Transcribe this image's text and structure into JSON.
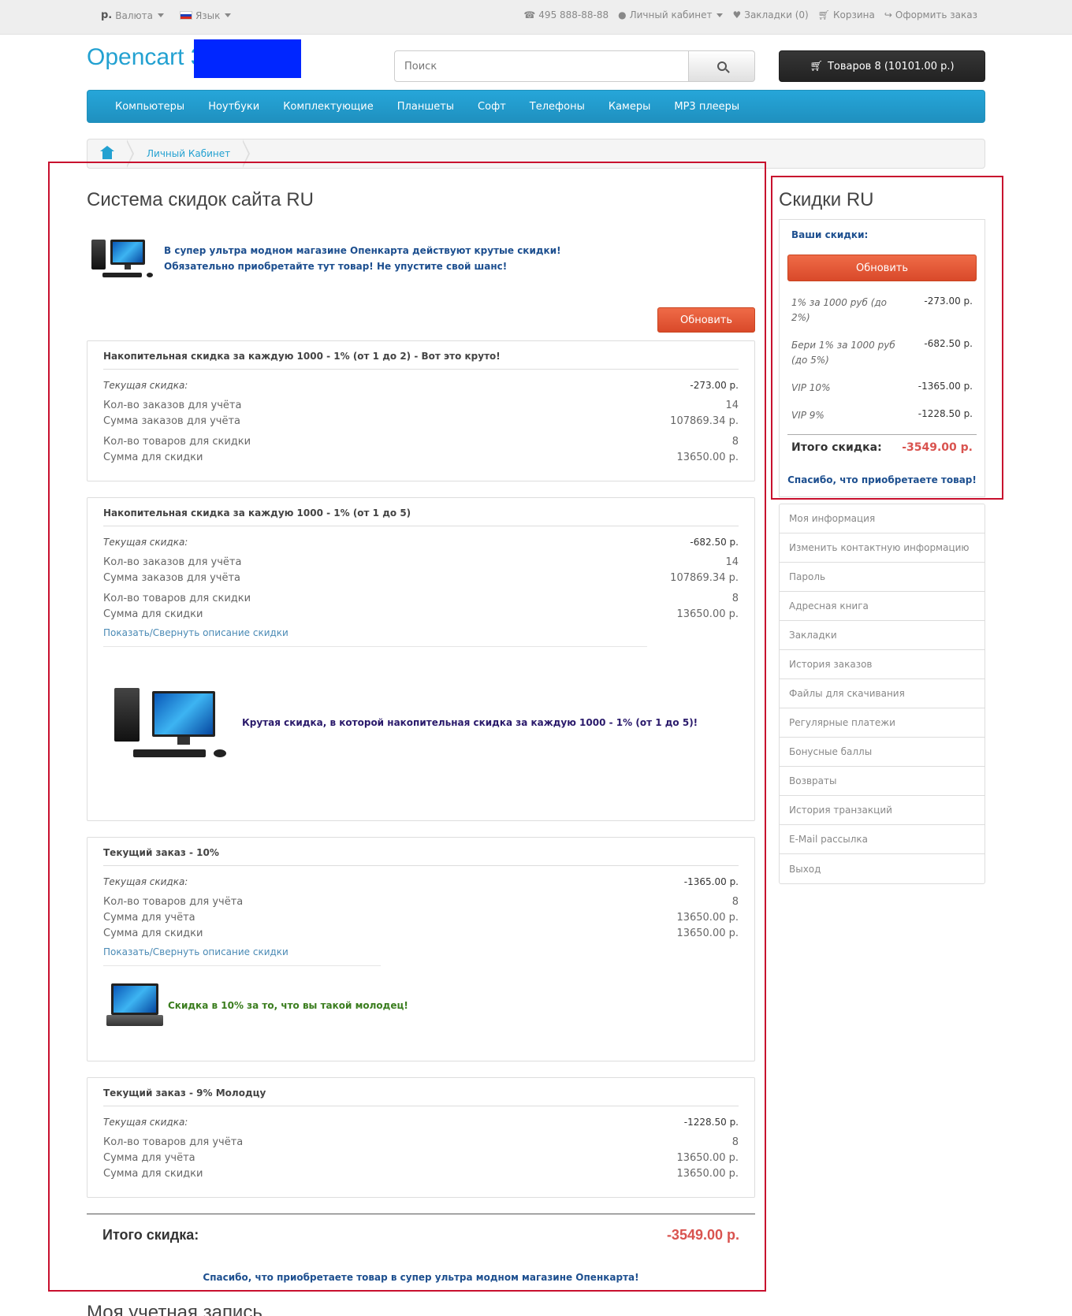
{
  "topbar": {
    "currency_symbol": "р.",
    "currency_label": "Валюта",
    "language_label": "Язык",
    "phone": "495 888-88-88",
    "account": "Личный кабинет",
    "wishlist": "Закладки (0)",
    "cart": "Корзина",
    "checkout": "Оформить заказ"
  },
  "header": {
    "logo": "Opencart 3",
    "search_placeholder": "Поиск",
    "cart_button": "Товаров 8 (10101.00 р.)"
  },
  "menu": [
    "Компьютеры",
    "Ноутбуки",
    "Комплектующие",
    "Планшеты",
    "Софт",
    "Телефоны",
    "Камеры",
    "MP3 плееры"
  ],
  "breadcrumb": {
    "link": "Личный Кабинет"
  },
  "main": {
    "title": "Система скидок сайта RU",
    "intro_line1": "В супер ультра модном магазине Опенкарта действуют крутые скидки!",
    "intro_line2": "Обязательно приобретайте тут товар! Не упустите свой шанс!",
    "refresh_button": "Обновить",
    "current_label": "Текущая скидка:",
    "toggle_label": "Показать/Свернуть описание скидки",
    "panels": [
      {
        "title": "Накопительная скидка за каждую 1000 - 1% (от 1 до 2) - Вот это круто!",
        "current": "-273.00 р.",
        "rows": [
          {
            "label": "Кол-во заказов для учёта",
            "value": "14"
          },
          {
            "label": "Сумма заказов для учёта",
            "value": "107869.34 р."
          },
          {
            "label": "Кол-во товаров для скидки",
            "value": "8"
          },
          {
            "label": "Сумма для скидки",
            "value": "13650.00 р."
          }
        ]
      },
      {
        "title": "Накопительная скидка за каждую 1000 - 1% (от 1 до 5)",
        "current": "-682.50 р.",
        "rows": [
          {
            "label": "Кол-во заказов для учёта",
            "value": "14"
          },
          {
            "label": "Сумма заказов для учёта",
            "value": "107869.34 р."
          },
          {
            "label": "Кол-во товаров для скидки",
            "value": "8"
          },
          {
            "label": "Сумма для скидки",
            "value": "13650.00 р."
          }
        ],
        "description": "Крутая скидка, в которой накопительная скидка за каждую 1000 - 1% (от 1 до 5)!"
      },
      {
        "title": "Текущий заказ - 10%",
        "current": "-1365.00 р.",
        "rows": [
          {
            "label": "Кол-во товаров для учёта",
            "value": "8"
          },
          {
            "label": "Сумма для учёта",
            "value": "13650.00 р."
          },
          {
            "label": "Сумма для скидки",
            "value": "13650.00 р."
          }
        ],
        "description": "Скидка в 10% за то, что вы такой молодец!"
      },
      {
        "title": "Текущий заказ - 9% Молодцу",
        "current": "-1228.50 р.",
        "rows": [
          {
            "label": "Кол-во товаров для учёта",
            "value": "8"
          },
          {
            "label": "Сумма для учёта",
            "value": "13650.00 р."
          },
          {
            "label": "Сумма для скидки",
            "value": "13650.00 р."
          }
        ]
      }
    ],
    "total_label": "Итого скидка:",
    "total_value": "-3549.00 р.",
    "thanks": "Спасибо, что приобретаете товар в супер ультра модном магазине Опенкарта!",
    "next_heading": "Моя учетная запись"
  },
  "sidebar": {
    "title": "Скидки RU",
    "subtitle": "Ваши скидки:",
    "refresh_button": "Обновить",
    "discounts": [
      {
        "name": "1% за 1000 руб (до 2%)",
        "value": "-273.00 р."
      },
      {
        "name": "Бери 1% за 1000 руб (до 5%)",
        "value": "-682.50 р."
      },
      {
        "name": "VIP 10%",
        "value": "-1365.00 р."
      },
      {
        "name": "VIP 9%",
        "value": "-1228.50 р."
      }
    ],
    "total_label": "Итого скидка:",
    "total_value": "-3549.00 р.",
    "thanks": "Спасибо, что приобретаете товар!",
    "account_links": [
      "Моя информация",
      "Изменить контактную информацию",
      "Пароль",
      "Адресная книга",
      "Закладки",
      "История заказов",
      "Файлы для скачивания",
      "Регулярные платежи",
      "Бонусные баллы",
      "Возвраты",
      "История транзакций",
      "E-Mail рассылка",
      "Выход"
    ]
  }
}
